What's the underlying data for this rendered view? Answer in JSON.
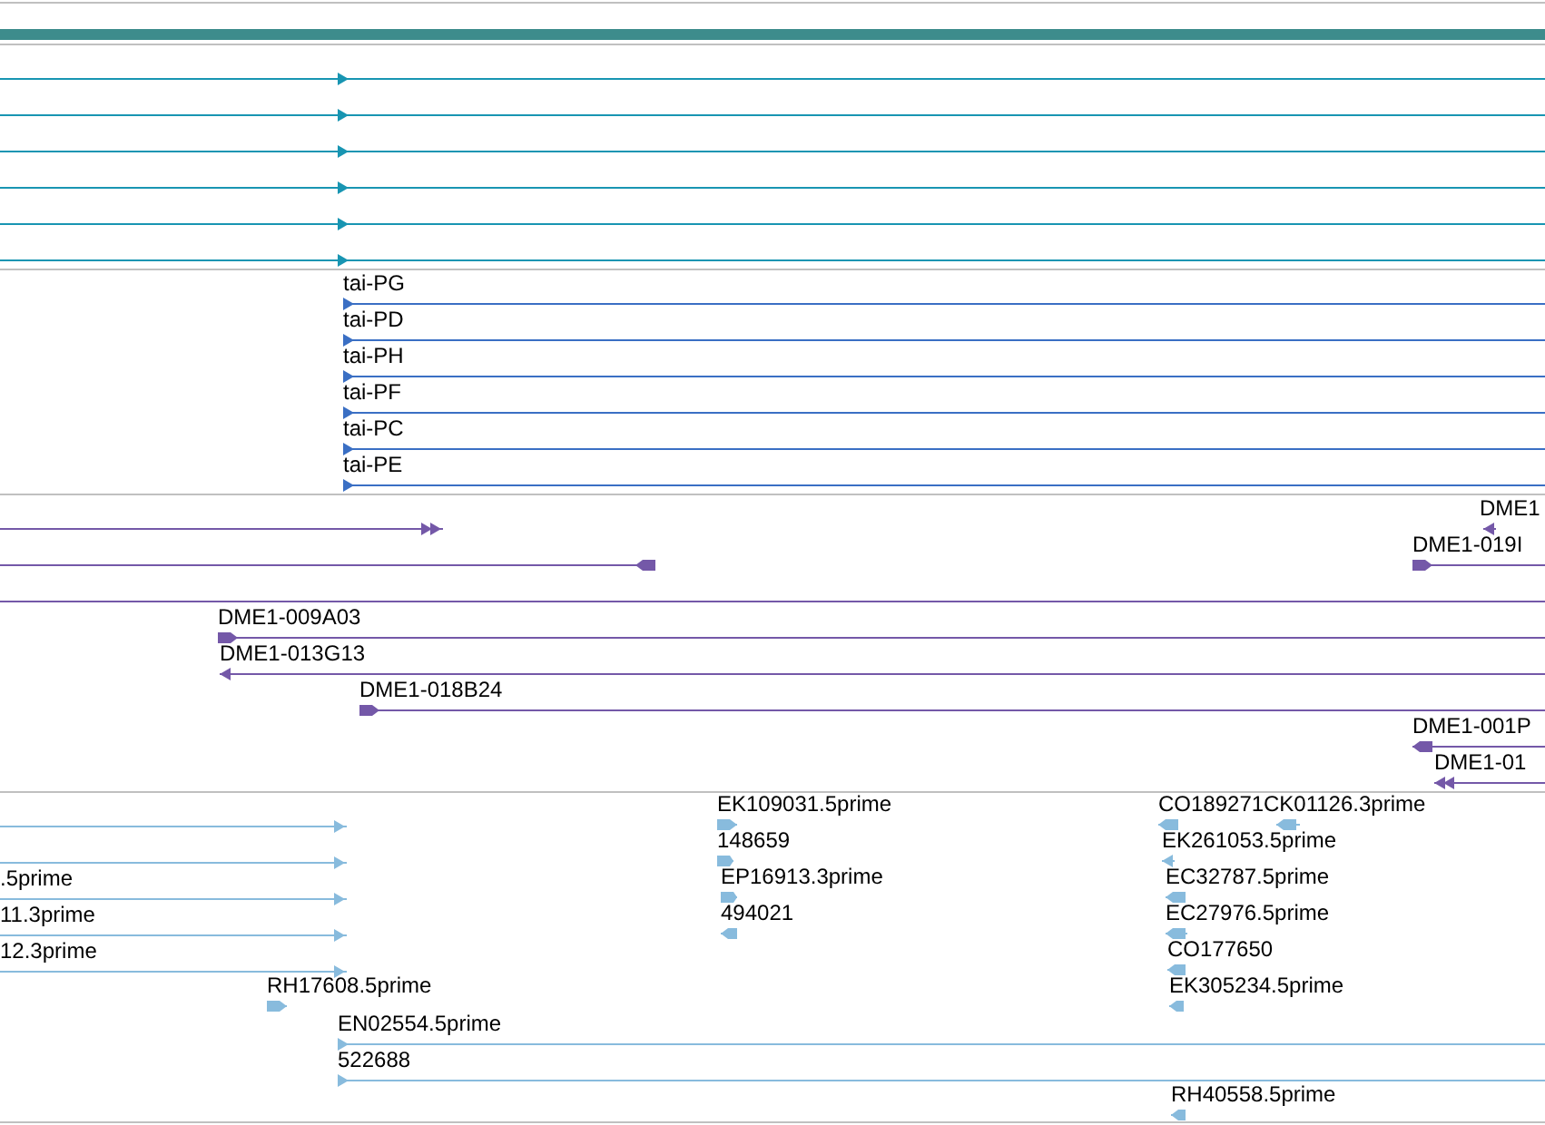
{
  "tracks": [
    {
      "features": [
        {
          "kind": "tri",
          "reverse": false
        },
        {
          "kind": "tri",
          "reverse": false
        },
        {
          "kind": "tri",
          "reverse": false
        },
        {
          "kind": "tri",
          "reverse": false
        },
        {
          "kind": "tri",
          "reverse": false
        },
        {
          "kind": "tri",
          "reverse": false
        }
      ]
    },
    {
      "features": [
        {
          "label": "tai-PG",
          "kind": "tri",
          "reverse": false
        },
        {
          "label": "tai-PD",
          "kind": "tri",
          "reverse": false
        },
        {
          "label": "tai-PH",
          "kind": "tri",
          "reverse": false
        },
        {
          "label": "tai-PF",
          "kind": "tri",
          "reverse": false
        },
        {
          "label": "tai-PC",
          "kind": "tri",
          "reverse": false
        },
        {
          "label": "tai-PE",
          "kind": "tri",
          "reverse": false
        }
      ]
    },
    {
      "features": [
        {
          "kind": "double",
          "reverse": false
        },
        {
          "kind": "block",
          "reverse": true
        },
        {
          "label": "DME1",
          "kind": "tri",
          "reverse": true
        },
        {
          "label": "DME1-019I",
          "kind": "block",
          "reverse": false
        },
        {
          "kind": "plain"
        },
        {
          "label": "DME1-009A03",
          "kind": "block",
          "reverse": false
        },
        {
          "label": "DME1-013G13",
          "kind": "tri",
          "reverse": true
        },
        {
          "label": "DME1-018B24",
          "kind": "block",
          "reverse": false
        },
        {
          "label": "DME1-001P",
          "kind": "block",
          "reverse": true
        },
        {
          "label": "DME1-01",
          "kind": "double",
          "reverse": true
        }
      ]
    },
    {
      "features": [
        {
          "kind": "tri",
          "reverse": false
        },
        {
          "kind": "tri",
          "reverse": false
        },
        {
          "label": ".5prime",
          "kind": "tri",
          "reverse": false
        },
        {
          "label": "11.3prime",
          "kind": "tri",
          "reverse": false
        },
        {
          "label": "12.3prime",
          "kind": "tri",
          "reverse": false
        },
        {
          "label": "RH17608.5prime",
          "kind": "block",
          "reverse": false
        },
        {
          "label": "EN02554.5prime",
          "kind": "tri",
          "reverse": false
        },
        {
          "label": "522688",
          "kind": "tri",
          "reverse": false
        },
        {
          "label": "EK109031.5prime",
          "kind": "block",
          "reverse": false
        },
        {
          "label": "148659",
          "kind": "block",
          "reverse": false
        },
        {
          "label": "EP16913.3prime",
          "kind": "block",
          "reverse": false
        },
        {
          "label": "494021",
          "kind": "block",
          "reverse": true
        },
        {
          "label": "CO189271",
          "kind": "block",
          "reverse": true
        },
        {
          "label": "CK01126.3prime",
          "kind": "block",
          "reverse": true
        },
        {
          "label": "EK261053.5prime",
          "kind": "tri",
          "reverse": true
        },
        {
          "label": "EC32787.5prime",
          "kind": "block",
          "reverse": true
        },
        {
          "label": "EC27976.5prime",
          "kind": "block",
          "reverse": true
        },
        {
          "label": "CO177650",
          "kind": "block",
          "reverse": true
        },
        {
          "label": "EK305234.5prime",
          "kind": "block",
          "reverse": true
        },
        {
          "label": "RH40558.5prime",
          "kind": "block",
          "reverse": true
        }
      ]
    }
  ]
}
